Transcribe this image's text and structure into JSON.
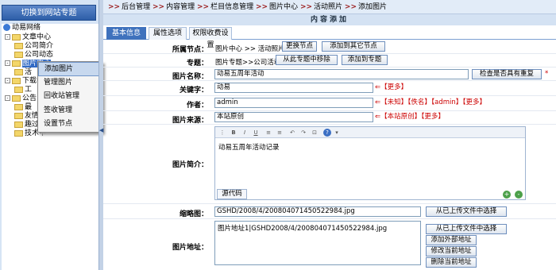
{
  "sidebar": {
    "switch_label": "切换到网站专题",
    "root": "动易网络",
    "items": [
      "文章中心",
      "公司简介",
      "公司动态",
      "图片中心",
      "活",
      "下载中",
      "工",
      "公告",
      "最",
      "友情链",
      "趣过链",
      "技术中"
    ]
  },
  "context_menu": {
    "items": [
      "添加图片",
      "管理图片",
      "回收站管理",
      "签收管理",
      "设置节点"
    ]
  },
  "breadcrumb": [
    "后台管理",
    "内容管理",
    "栏目信息管理",
    "图片中心",
    "活动照片",
    "添加图片"
  ],
  "page_title": "内容添加",
  "tabs": [
    "基本信息",
    "属性选项",
    "权限收费设置"
  ],
  "form": {
    "node_label": "所属节点：",
    "node_value": "图片中心 >> 活动照片",
    "change_node_btn": "更换节点",
    "add_other_node_btn": "添加到其它节点",
    "special_label": "专题：",
    "special_value": "图片专题>>公司活动",
    "remove_special_btn": "从此专题中移除",
    "add_special_btn": "添加到专题",
    "title_label": "图片名称：",
    "title_value": "动易五周年活动",
    "check_dup_btn": "检查是否具有重复",
    "required_mark": "*",
    "keyword_label": "关键字：",
    "keyword_value": "动易",
    "keyword_more": "【更多】",
    "author_label": "作者：",
    "author_value": "admin",
    "author_unknown": "【未知】",
    "author_anon": "【佚名】",
    "author_admin": "【admin】",
    "author_more": "【更多】",
    "source_label": "图片来源：",
    "source_value": "本站原创",
    "source_orig": "【本站原创】",
    "source_more": "【更多】",
    "intro_label": "图片简介：",
    "intro_value": "动易五周年活动记录",
    "source_code_btn": "源代码",
    "thumb_label": "缩略图：",
    "thumb_value": "GSHD/2008/4/200804071450522984.jpg",
    "thumb_select_btn": "从已上传文件中选择",
    "addr_label": "图片地址：",
    "addr_value": "图片地址1|GSHD2008/4/200804071450522984.jpg",
    "addr_select_btn": "从已上传文件中选择",
    "addr_add_btn": "添加外部地址",
    "addr_edit_btn": "修改当前地址",
    "addr_del_btn": "删除当前地址",
    "arrow": "⇐"
  },
  "editor_tools": [
    "B",
    "I",
    "U",
    "≡",
    "≡",
    "↶",
    "↷",
    "⊡",
    "?"
  ]
}
